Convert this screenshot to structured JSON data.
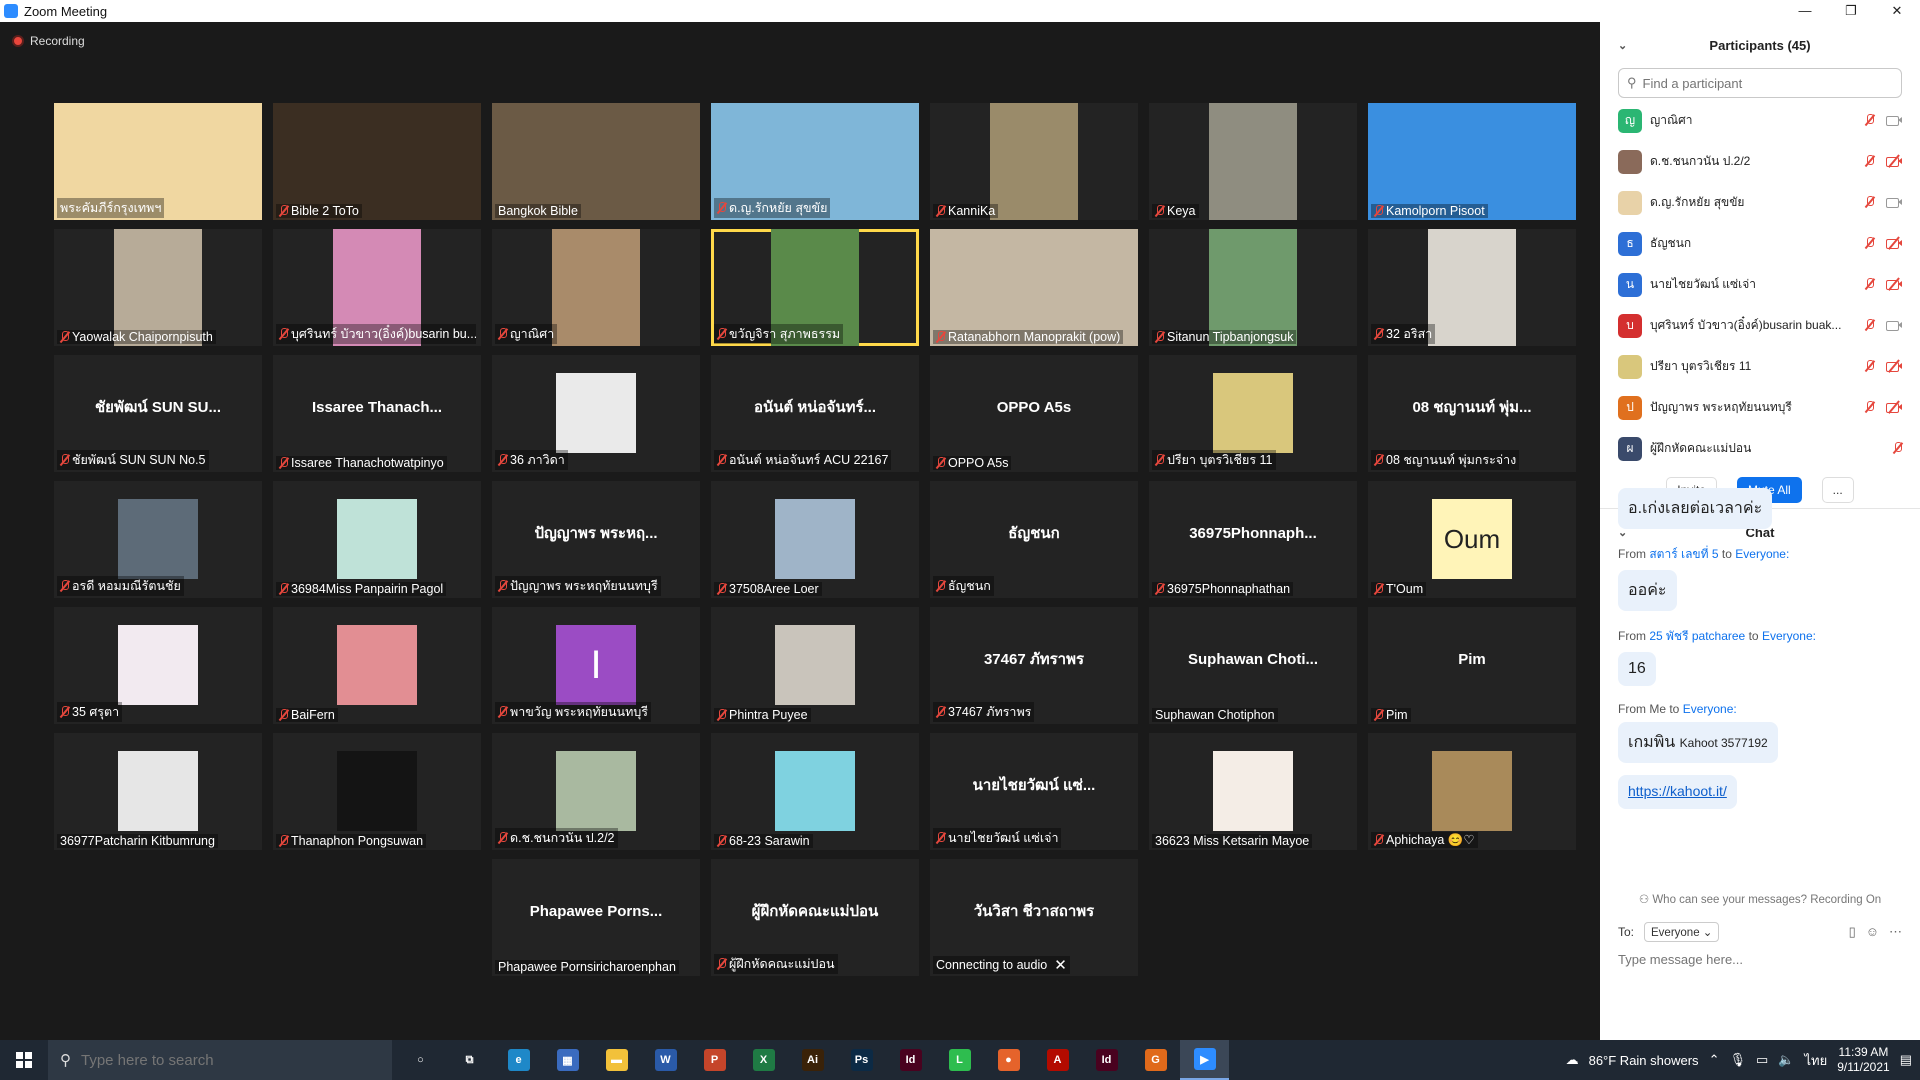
{
  "window": {
    "title": "Zoom Meeting",
    "minimize": "—",
    "restore": "❐",
    "close": "✕"
  },
  "recording": "Recording",
  "tiles": [
    {
      "label": "พระคัมภีร์กรุงเทพฯ",
      "muted": false,
      "kind": "video",
      "color": "#f0d7a1"
    },
    {
      "label": "Bible 2 ToTo",
      "muted": true,
      "kind": "video",
      "color": "#3b2e22"
    },
    {
      "label": "Bangkok Bible",
      "muted": false,
      "kind": "video",
      "color": "#6b5a45"
    },
    {
      "label": "ด.ญ.รักหยัย สุขขัย",
      "muted": true,
      "kind": "video",
      "color": "#7fb6d8"
    },
    {
      "label": "KanniKa",
      "muted": true,
      "kind": "video",
      "color": "#9a8b6a"
    },
    {
      "label": "Keya",
      "muted": true,
      "kind": "video",
      "color": "#8f8d80"
    },
    {
      "label": "Kamolporn Pisoot",
      "muted": true,
      "kind": "video",
      "color": "#3a8fe0"
    },
    {
      "label": "Yaowalak Chaipornpisuth",
      "muted": true,
      "kind": "video",
      "color": "#b7ab98"
    },
    {
      "label": "บุศรินทร์ บัวขาว(อิ๋งค์)busarin bu...",
      "muted": true,
      "kind": "video",
      "color": "#d48ab5"
    },
    {
      "label": "ญาณิศา",
      "muted": true,
      "kind": "video",
      "color": "#a98b6a"
    },
    {
      "label": "ขวัญจิรา สุภาพธรรม",
      "muted": true,
      "kind": "video",
      "color": "#5a8a4a",
      "active": true
    },
    {
      "label": "Ratanabhorn Manoprakit (pow)",
      "muted": true,
      "kind": "video",
      "color": "#c4b7a3"
    },
    {
      "label": "Sitanun Tipbanjongsuk",
      "muted": true,
      "kind": "video",
      "color": "#6f9a6c"
    },
    {
      "label": "32 อริสา",
      "muted": true,
      "kind": "video",
      "color": "#d8d4cc"
    },
    {
      "label": "ชัยพัฒน์ SUN SUN No.5",
      "muted": true,
      "kind": "name",
      "name": "ชัยพัฒน์ SUN SU..."
    },
    {
      "label": "Issaree Thanachotwatpinyo",
      "muted": true,
      "kind": "name",
      "name": "Issaree Thanach..."
    },
    {
      "label": "36 ภาวิดา",
      "muted": true,
      "kind": "avatar",
      "color": "#eaeaea"
    },
    {
      "label": "อนันต์ หน่อจันทร์ ACU 22167",
      "muted": true,
      "kind": "name",
      "name": "อนันต์ หน่อจันทร์..."
    },
    {
      "label": "OPPO A5s",
      "muted": true,
      "kind": "name",
      "name": "OPPO A5s"
    },
    {
      "label": "ปรียา บุตรวิเชียร  11",
      "muted": true,
      "kind": "avatar",
      "color": "#d9c77c"
    },
    {
      "label": "08 ชญานนท์ พุ่มกระจ่าง",
      "muted": true,
      "kind": "name",
      "name": "08 ชญานนท์ พุ่ม..."
    },
    {
      "label": "อรดี หอมมณีรัตนชัย",
      "muted": true,
      "kind": "avatar",
      "color": "#5d6b78"
    },
    {
      "label": "36984Miss Panpairin Pagol",
      "muted": true,
      "kind": "avatar",
      "color": "#bfe2d8"
    },
    {
      "label": "ปัญญาพร พระหฤทัยนนทบุรี",
      "muted": true,
      "kind": "name",
      "name": "ปัญญาพร พระหฤ..."
    },
    {
      "label": "37508Aree Loer",
      "muted": true,
      "kind": "avatar",
      "color": "#9fb4c8"
    },
    {
      "label": "ธัญชนก",
      "muted": true,
      "kind": "name",
      "name": "ธัญชนก"
    },
    {
      "label": "36975Phonnaphathan",
      "muted": true,
      "kind": "name",
      "name": "36975Phonnaph..."
    },
    {
      "label": "T'Oum",
      "muted": true,
      "kind": "oum",
      "color": "#fff4b8",
      "text": "Oum"
    },
    {
      "label": "35 ศรุตา",
      "muted": true,
      "kind": "avatar",
      "color": "#f2eaf0"
    },
    {
      "label": "BaiFern",
      "muted": true,
      "kind": "avatar",
      "color": "#e28e93"
    },
    {
      "label": "พาขวัญ พระหฤทัยนนทบุรี",
      "muted": true,
      "kind": "letter",
      "color": "#9b4cc4",
      "text": "I"
    },
    {
      "label": "Phintra Puyee",
      "muted": true,
      "kind": "avatar",
      "color": "#c9c4bb"
    },
    {
      "label": "37467 ภัทราพร",
      "muted": true,
      "kind": "name",
      "name": "37467 ภัทราพร"
    },
    {
      "label": "Suphawan Chotiphon",
      "muted": false,
      "kind": "name",
      "name": "Suphawan Choti..."
    },
    {
      "label": "Pim",
      "muted": true,
      "kind": "name",
      "name": "Pim"
    },
    {
      "label": "36977Patcharin Kitbumrung",
      "muted": false,
      "kind": "avatar",
      "color": "#e6e6e6"
    },
    {
      "label": "Thanaphon Pongsuwan",
      "muted": true,
      "kind": "avatar",
      "color": "#141414"
    },
    {
      "label": "ด.ช.ชนกวนัน ป.2/2",
      "muted": true,
      "kind": "avatar",
      "color": "#a9b9a0"
    },
    {
      "label": "68-23 Sarawin",
      "muted": true,
      "kind": "avatar",
      "color": "#7fd2e0"
    },
    {
      "label": "นายไชยวัฒน์ แซ่เจ่า",
      "muted": true,
      "kind": "name",
      "name": "นายไชยวัฒน์ แซ่..."
    },
    {
      "label": "36623 Miss Ketsarin Mayoe",
      "muted": false,
      "kind": "avatar",
      "color": "#f4ede6"
    },
    {
      "label": "Aphichaya 😊♡",
      "muted": true,
      "kind": "avatar",
      "color": "#a98a5a"
    },
    {
      "label": "Phapawee Pornsiricharoenphan",
      "muted": false,
      "kind": "name",
      "name": "Phapawee Porns..."
    },
    {
      "label": "ผู้ฝึกหัดคณะแม่ปอน",
      "muted": true,
      "kind": "name",
      "name": "ผู้ฝึกหัดคณะแม่ปอน"
    },
    {
      "label": "Connecting to audio",
      "muted": false,
      "kind": "name",
      "name": "วันวิสา ชีวาสถาพร",
      "closable": true
    }
  ],
  "participants": {
    "title": "Participants (45)",
    "search_placeholder": "Find a participant",
    "list": [
      {
        "initial": "ญ",
        "name": "ญาณิศา",
        "color": "#2bb673",
        "cam_off": false
      },
      {
        "initial": "",
        "name": "ด.ช.ชนกวนัน ป.2/2",
        "color": "#8a6a5a",
        "cam_off": true
      },
      {
        "initial": "",
        "name": "ด.ญ.รักหยัย สุขขัย",
        "color": "#e8d2a8",
        "cam_off": false
      },
      {
        "initial": "ธ",
        "name": "ธัญชนก",
        "color": "#2d6fd6",
        "cam_off": true
      },
      {
        "initial": "น",
        "name": "นายไชยวัฒน์ แซ่เจ่า",
        "color": "#2d6fd6",
        "cam_off": true
      },
      {
        "initial": "บ",
        "name": "บุศรินทร์ บัวขาว(อิ๋งค์)busarin buak...",
        "color": "#d42f2f",
        "cam_off": false
      },
      {
        "initial": "",
        "name": "ปรียา บุตรวิเชียร  11",
        "color": "#d9c77c",
        "cam_off": true
      },
      {
        "initial": "ป",
        "name": "ปัญญาพร พระหฤทัยนนทบุรี",
        "color": "#e0701e",
        "cam_off": true
      },
      {
        "initial": "ผ",
        "name": "ผู้ฝึกหัดคณะแม่ปอน",
        "color": "#3a4a6b",
        "cam_off": null
      }
    ],
    "invite": "Invite",
    "mute_all": "Mute All",
    "more": "..."
  },
  "chat": {
    "title": "Chat",
    "top_bubble": "อ.เก่งเลยต่อเวลาค่ะ",
    "messages": [
      {
        "from": "From",
        "sender": "สตาร์ เลขที่ 5",
        "to": "to",
        "recipient": "Everyone:",
        "text": "ออค่ะ"
      },
      {
        "from": "From",
        "sender": "25 พัชรี patcharee",
        "to": "to",
        "recipient": "Everyone:",
        "text": "16"
      }
    ],
    "me": {
      "from": "From Me to",
      "recipient": "Everyone:",
      "text_thai": "เกมพิน",
      "text_code": "Kahoot 3577192",
      "link": "https://kahoot.it/"
    },
    "who_can_see": "Who can see your messages? Recording On",
    "to_label": "To:",
    "to_value": "Everyone",
    "input_placeholder": "Type message here..."
  },
  "taskbar": {
    "search_placeholder": "Type here to search",
    "apps": [
      {
        "name": "cortana-icon",
        "glyph": "○",
        "color": "transparent"
      },
      {
        "name": "task-view-icon",
        "glyph": "⧉",
        "color": "transparent"
      },
      {
        "name": "edge-icon",
        "glyph": "e",
        "color": "#1e88c8"
      },
      {
        "name": "calculator-icon",
        "glyph": "▦",
        "color": "#3a6bbf"
      },
      {
        "name": "file-explorer-icon",
        "glyph": "▬",
        "color": "#f2c13a"
      },
      {
        "name": "word-icon",
        "glyph": "W",
        "color": "#2a5aa8"
      },
      {
        "name": "powerpoint-icon",
        "glyph": "P",
        "color": "#c5452a"
      },
      {
        "name": "excel-icon",
        "glyph": "X",
        "color": "#1f7a44"
      },
      {
        "name": "illustrator-icon",
        "glyph": "Ai",
        "color": "#3a2208"
      },
      {
        "name": "photoshop-icon",
        "glyph": "Ps",
        "color": "#0c2a45"
      },
      {
        "name": "indesign-icon",
        "glyph": "Id",
        "color": "#49021f"
      },
      {
        "name": "line-icon",
        "glyph": "L",
        "color": "#2ebd4f"
      },
      {
        "name": "firefox-icon",
        "glyph": "●",
        "color": "#e5632b"
      },
      {
        "name": "acrobat-icon",
        "glyph": "A",
        "color": "#b30b00"
      },
      {
        "name": "indesign2-icon",
        "glyph": "Id",
        "color": "#49021f"
      },
      {
        "name": "grammarly-icon",
        "glyph": "G",
        "color": "#e06a1b"
      },
      {
        "name": "zoom-icon",
        "glyph": "▶",
        "color": "#2d8cff"
      }
    ],
    "weather": "86°F  Rain showers",
    "lang": "ไทย",
    "time": "11:39 AM",
    "date": "9/11/2021"
  }
}
